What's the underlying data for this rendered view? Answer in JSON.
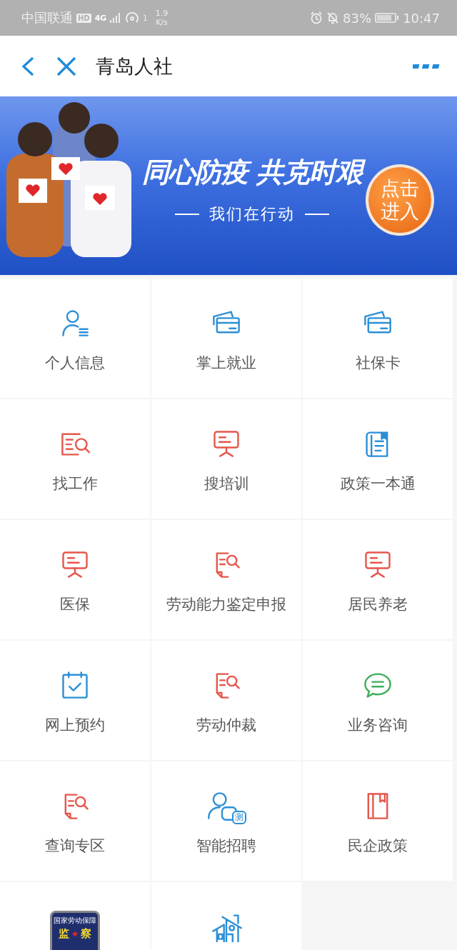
{
  "status_bar": {
    "carrier": "中国联通",
    "hd": "HD",
    "network": "4G",
    "hotspot_count": "1",
    "speed": "1.9",
    "speed_unit": "K/s",
    "battery": "83%",
    "time": "10:47"
  },
  "nav": {
    "title": "青岛人社"
  },
  "banner": {
    "headline": "同心防疫 共克时艰",
    "subline": "我们在行动",
    "button": "点击进入"
  },
  "grid": [
    {
      "tiles": [
        {
          "kind": "person",
          "color": "#2c8fd6",
          "label": "个人信息"
        },
        {
          "kind": "card",
          "color": "#2c8fd6",
          "label": "掌上就业"
        },
        {
          "kind": "card",
          "color": "#2c8fd6",
          "label": "社保卡"
        }
      ]
    },
    {
      "tiles": [
        {
          "kind": "search-doc",
          "color": "#e5574c",
          "label": "找工作"
        },
        {
          "kind": "board",
          "color": "#e5574c",
          "label": "搜培训"
        },
        {
          "kind": "book",
          "color": "#2c8fd6",
          "label": "政策一本通"
        }
      ]
    },
    {
      "tiles": [
        {
          "kind": "board",
          "color": "#e5574c",
          "label": "医保"
        },
        {
          "kind": "doc-search",
          "color": "#e5574c",
          "label": "劳动能力鉴定申报"
        },
        {
          "kind": "board",
          "color": "#e5574c",
          "label": "居民养老"
        }
      ]
    },
    {
      "tiles": [
        {
          "kind": "calendar",
          "color": "#2c8fd6",
          "label": "网上预约"
        },
        {
          "kind": "doc-search",
          "color": "#e5574c",
          "label": "劳动仲裁"
        },
        {
          "kind": "chat",
          "color": "#3cad5a",
          "label": "业务咨询"
        }
      ]
    },
    {
      "tiles": [
        {
          "kind": "doc-search",
          "color": "#e5574c",
          "label": "查询专区"
        },
        {
          "kind": "person-test",
          "color": "#2c8fd6",
          "label": "智能招聘",
          "badge": "测"
        },
        {
          "kind": "folder",
          "color": "#e5574c",
          "label": "民企政策"
        }
      ]
    },
    {
      "tiles": [
        {
          "kind": "shield",
          "color": "#1f2f6e",
          "top_text": "国家劳动保障",
          "left_text": "监",
          "right_text": "察"
        },
        {
          "kind": "house",
          "color": "#2c8fd6"
        },
        {
          "kind": "empty"
        }
      ]
    }
  ]
}
